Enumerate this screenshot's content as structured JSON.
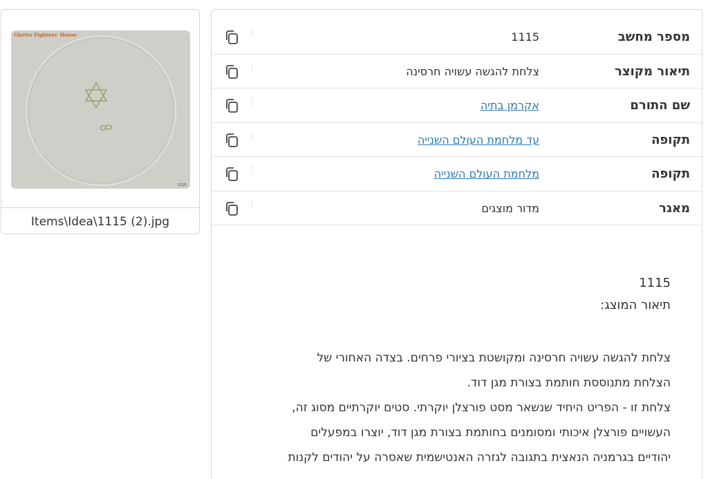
{
  "thumbnail": {
    "image_alt": "Items\\Idea\\1115 (2).jpg",
    "watermark": "Ghetto Fighters' House",
    "image_number": "1115",
    "caption": "Items\\Idea\\1115 (2).jpg"
  },
  "details": {
    "rows": [
      {
        "label": "מספר מחשב",
        "value": "1115",
        "is_link": false
      },
      {
        "label": "תיאור מקוצר",
        "value": "צלחת להגשה עשויה חרסינה",
        "is_link": false
      },
      {
        "label": "שם התורם",
        "value": "אקרמן בתיה",
        "is_link": true
      },
      {
        "label": "תקופה",
        "value": "עד מלחמת העולם השנייה",
        "is_link": true
      },
      {
        "label": "תקופה",
        "value": "מלחמת העולם השנייה",
        "is_link": true
      },
      {
        "label": "מאגר",
        "value": "מדור מוצגים",
        "is_link": false
      }
    ]
  },
  "description": {
    "number": "1115",
    "subheading": "תיאור המוצג:",
    "paragraph1_line1": "צלחת להגשה עשויה חרסינה ומקושטת בציורי פרחים. בצדה האחורי של",
    "paragraph1_line2": "הצלחת מתנוססת חותמת בצורת מגן דוד.",
    "paragraph2_line1": "צלחת זו - הפריט היחיד שנשאר מסט פורצלן יוקרתי. סטים יוקרתיים מסוג זה,",
    "paragraph2_line2": "העשויים פורצלן איכותי ומסומנים בחותמת בצורת מגן דוד, יוצרו במפעלים",
    "paragraph2_line3": "יהודיים בגרמניה הנאצית בתגובה לגזרה האנטישמית שאסרה על יהודים לקנות"
  },
  "icons": {
    "copy": "copy-icon",
    "drag": "drag-handle-icon"
  }
}
